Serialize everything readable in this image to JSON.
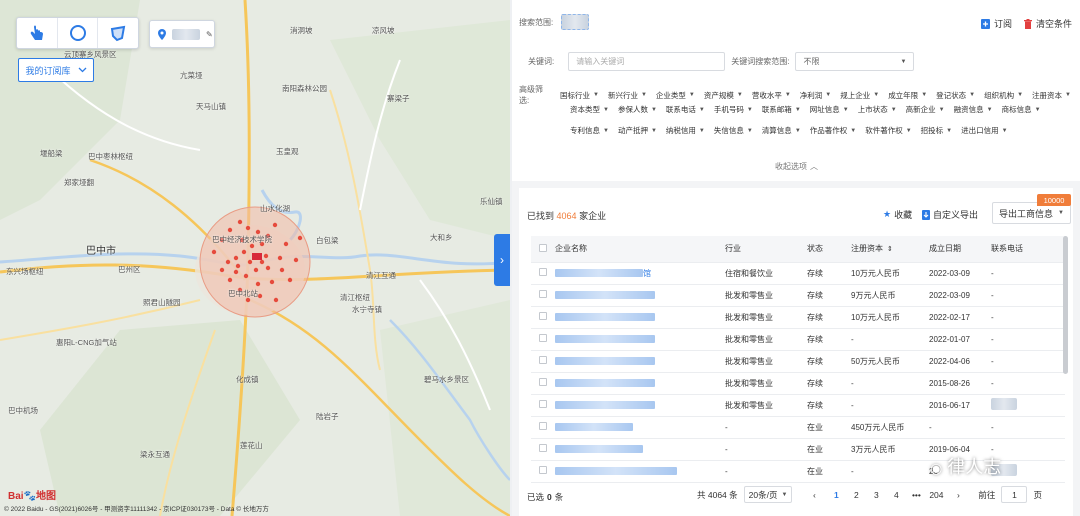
{
  "map": {
    "tools": [
      "pointer-hand-icon",
      "circle-select-icon",
      "polygon-select-icon"
    ],
    "location_value": "",
    "subscription_button": "我的订阅库",
    "logo_text": "Bai",
    "logo_text2": "地图",
    "copyright": "© 2022 Baidu - GS(2021)6026号 - 甲测资字11111342 - 京ICP证030173号 - Data © 长地万方",
    "labels": [
      {
        "t": "消洞坡"
      },
      {
        "t": "凉风坡"
      },
      {
        "t": "云顶寨乡风景区"
      },
      {
        "t": "亢菜垭"
      },
      {
        "t": "天马山镇"
      },
      {
        "t": "南阳森林公园"
      },
      {
        "t": "寨梁子"
      },
      {
        "t": "堰船梁"
      },
      {
        "t": "巴中枣林枢纽"
      },
      {
        "t": "郑家垭翻"
      },
      {
        "t": "巴中经济技术学院"
      },
      {
        "t": "玉皇观"
      },
      {
        "t": "山水化湖"
      },
      {
        "t": "白包梁"
      },
      {
        "t": "巴中市",
        "big": true
      },
      {
        "t": "巴州区"
      },
      {
        "t": "东兴场枢纽"
      },
      {
        "t": "清江互通"
      },
      {
        "t": "清江枢纽"
      },
      {
        "t": "照君山隧园"
      },
      {
        "t": "惠阳L-CNG加气站"
      },
      {
        "t": "巴中机场"
      },
      {
        "t": "化成镇"
      },
      {
        "t": "碧马水乡景区"
      },
      {
        "t": "陆岩子"
      },
      {
        "t": "莲花山"
      },
      {
        "t": "梁永互通"
      },
      {
        "t": "水宁寺镇"
      },
      {
        "t": "大和乡"
      },
      {
        "t": "巴中北站"
      },
      {
        "t": "乐仙镇"
      }
    ]
  },
  "search": {
    "range_label": "搜索范围:",
    "range_value": "",
    "subscribe": "订阅",
    "clear": "清空条件",
    "keyword_label": "关键词:",
    "keyword_placeholder": "请输入关键词",
    "keyword_range_label": "关键词搜索范围:",
    "keyword_range_value": "不限",
    "advanced_label": "高级筛选:",
    "filters_row1": [
      "国标行业",
      "新兴行业",
      "企业类型",
      "资产规模",
      "营收水平",
      "净利润",
      "规上企业",
      "成立年限",
      "登记状态",
      "组织机构",
      "注册资本"
    ],
    "filters_row2": [
      "资本类型",
      "参保人数",
      "联系电话",
      "手机号码",
      "联系邮箱",
      "网址信息",
      "上市状态",
      "高新企业",
      "融资信息",
      "商标信息"
    ],
    "filters_row3": [
      "专利信息",
      "动产抵押",
      "纳税信用",
      "失信信息",
      "清算信息",
      "作品著作权",
      "软件著作权",
      "招投标",
      "进出口信用"
    ],
    "collapse_label": "收起选项"
  },
  "results": {
    "found_prefix": "已找到",
    "count": "4064",
    "found_suffix": "家企业",
    "collect": "收藏",
    "custom_export": "自定义导出",
    "export_business": "导出工商信息",
    "badge": "10000",
    "columns": [
      "企业名称",
      "行业",
      "状态",
      "注册资本",
      "成立日期",
      "联系电话"
    ],
    "rows": [
      {
        "name_tail": "馆",
        "industry": "住宿和餐饮业",
        "status": "存续",
        "capital": "10万元人民币",
        "date": "2022-03-09",
        "phone": "-"
      },
      {
        "name_tail": "",
        "industry": "批发和零售业",
        "status": "存续",
        "capital": "9万元人民币",
        "date": "2022-03-09",
        "phone": "-"
      },
      {
        "name_tail": "",
        "industry": "批发和零售业",
        "status": "存续",
        "capital": "10万元人民币",
        "date": "2022-02-17",
        "phone": "-"
      },
      {
        "name_tail": "",
        "industry": "批发和零售业",
        "status": "存续",
        "capital": "-",
        "date": "2022-01-07",
        "phone": "-"
      },
      {
        "name_tail": "",
        "industry": "批发和零售业",
        "status": "存续",
        "capital": "50万元人民币",
        "date": "2022-04-06",
        "phone": "-"
      },
      {
        "name_tail": "",
        "industry": "批发和零售业",
        "status": "存续",
        "capital": "-",
        "date": "2015-08-26",
        "phone": "-"
      },
      {
        "name_tail": "",
        "industry": "批发和零售业",
        "status": "存续",
        "capital": "-",
        "date": "2016-06-17",
        "phone": ""
      },
      {
        "name_tail": "",
        "industry": "-",
        "status": "在业",
        "capital": "450万元人民币",
        "date": "-",
        "phone": "-"
      },
      {
        "name_tail": "",
        "industry": "-",
        "status": "在业",
        "capital": "3万元人民币",
        "date": "2019-06-04",
        "phone": "-"
      },
      {
        "name_tail": "",
        "industry": "-",
        "status": "在业",
        "capital": "-",
        "date": "20",
        "phone": ""
      }
    ],
    "selected_prefix": "已选",
    "selected_count": "0",
    "selected_suffix": "条",
    "total_text": "共 4064 条",
    "page_size": "20条/页",
    "pages": [
      "1",
      "2",
      "3",
      "4",
      "•••",
      "204"
    ],
    "goto_label": "前往",
    "goto_value": "1",
    "goto_suffix": "页"
  },
  "watermark": "律人志",
  "colors": {
    "accent": "#2d7be5",
    "count": "#f07d3a",
    "circle": "#f2b9a6",
    "dot": "#e64a3c"
  }
}
